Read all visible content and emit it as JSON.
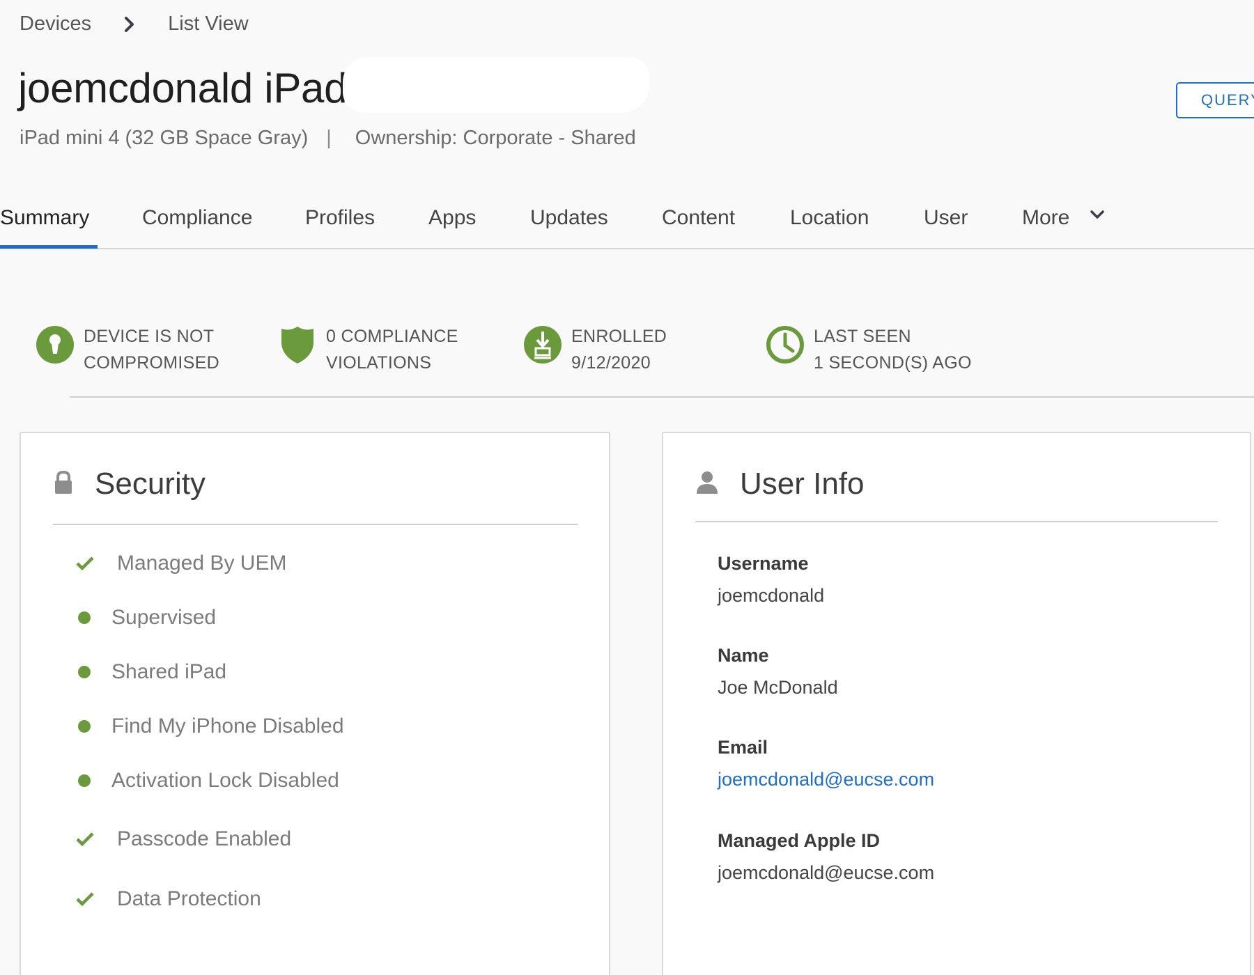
{
  "breadcrumb": {
    "root": "Devices",
    "current": "List View"
  },
  "device": {
    "title": "joemcdonald iPad",
    "model": "iPad mini 4 (32 GB Space Gray)",
    "divider": "|",
    "ownership": "Ownership: Corporate - Shared"
  },
  "actions": {
    "query_label": "QUERY"
  },
  "tabs": [
    {
      "label": "Summary",
      "active": true
    },
    {
      "label": "Compliance"
    },
    {
      "label": "Profiles"
    },
    {
      "label": "Apps"
    },
    {
      "label": "Updates"
    },
    {
      "label": "Content"
    },
    {
      "label": "Location"
    },
    {
      "label": "User"
    },
    {
      "label": "More"
    }
  ],
  "status": [
    {
      "icon": "keyhole-icon",
      "line1": "DEVICE IS NOT",
      "line2": "COMPROMISED"
    },
    {
      "icon": "shield-icon",
      "line1": "0 COMPLIANCE",
      "line2": "VIOLATIONS"
    },
    {
      "icon": "enroll-download-icon",
      "line1": "ENROLLED",
      "line2": "9/12/2020"
    },
    {
      "icon": "clock-icon",
      "line1": "LAST SEEN",
      "line2": "1 SECOND(S) AGO"
    }
  ],
  "colors": {
    "accent": "#1f6fc5",
    "status_green": "#6a9a3b"
  },
  "security": {
    "title": "Security",
    "icon": "lock-icon",
    "items": [
      {
        "label": "Managed By UEM",
        "marker": "check"
      },
      {
        "label": "Supervised",
        "marker": "dot"
      },
      {
        "label": "Shared iPad",
        "marker": "dot"
      },
      {
        "label": "Find My iPhone Disabled",
        "marker": "dot"
      },
      {
        "label": "Activation Lock Disabled",
        "marker": "dot"
      },
      {
        "label": "Passcode Enabled",
        "marker": "check"
      },
      {
        "label": "Data Protection",
        "marker": "check"
      }
    ]
  },
  "user_info": {
    "title": "User Info",
    "icon": "user-icon",
    "fields": [
      {
        "label": "Username",
        "value": "joemcdonald"
      },
      {
        "label": "Name",
        "value": "Joe McDonald"
      },
      {
        "label": "Email",
        "value": "joemcdonald@eucse.com",
        "link": true
      },
      {
        "label": "Managed Apple ID",
        "value": "joemcdonald@eucse.com"
      }
    ]
  }
}
